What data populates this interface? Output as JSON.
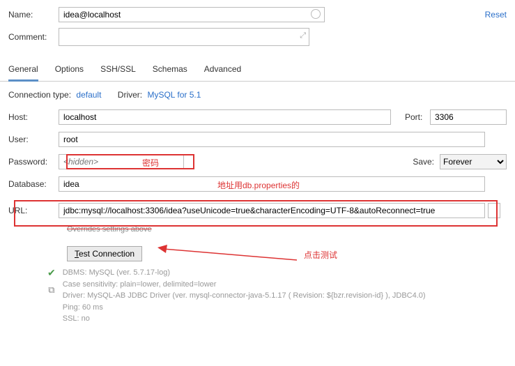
{
  "header": {
    "name_label": "Name:",
    "name_value": "idea@localhost",
    "reset": "Reset",
    "comment_label": "Comment:"
  },
  "tabs": [
    "General",
    "Options",
    "SSH/SSL",
    "Schemas",
    "Advanced"
  ],
  "connection": {
    "type_label": "Connection type:",
    "type_value": "default",
    "driver_label": "Driver:",
    "driver_value": "MySQL for 5.1"
  },
  "fields": {
    "host_label": "Host:",
    "host_value": "localhost",
    "port_label": "Port:",
    "port_value": "3306",
    "user_label": "User:",
    "user_value": "root",
    "password_label": "Password:",
    "password_placeholder": "<hidden>",
    "save_label": "Save:",
    "save_value": "Forever",
    "database_label": "Database:",
    "database_value": "idea",
    "url_label": "URL:",
    "url_value": "jdbc:mysql://localhost:3306/idea?useUnicode=true&characterEncoding=UTF-8&autoReconnect=true",
    "overrides": "Overrides settings above"
  },
  "annotations": {
    "password": "密码",
    "database": "地址用db.properties的",
    "test": "点击测试"
  },
  "test": {
    "button_prefix": "T",
    "button_rest": "est Connection"
  },
  "result": {
    "line1": "DBMS: MySQL (ver. 5.7.17-log)",
    "line2": "Case sensitivity: plain=lower, delimited=lower",
    "line3": "Driver: MySQL-AB JDBC Driver (ver. mysql-connector-java-5.1.17 ( Revision: ${bzr.revision-id} ), JDBC4.0)",
    "line4": "Ping: 60 ms",
    "line5": "SSL: no"
  }
}
